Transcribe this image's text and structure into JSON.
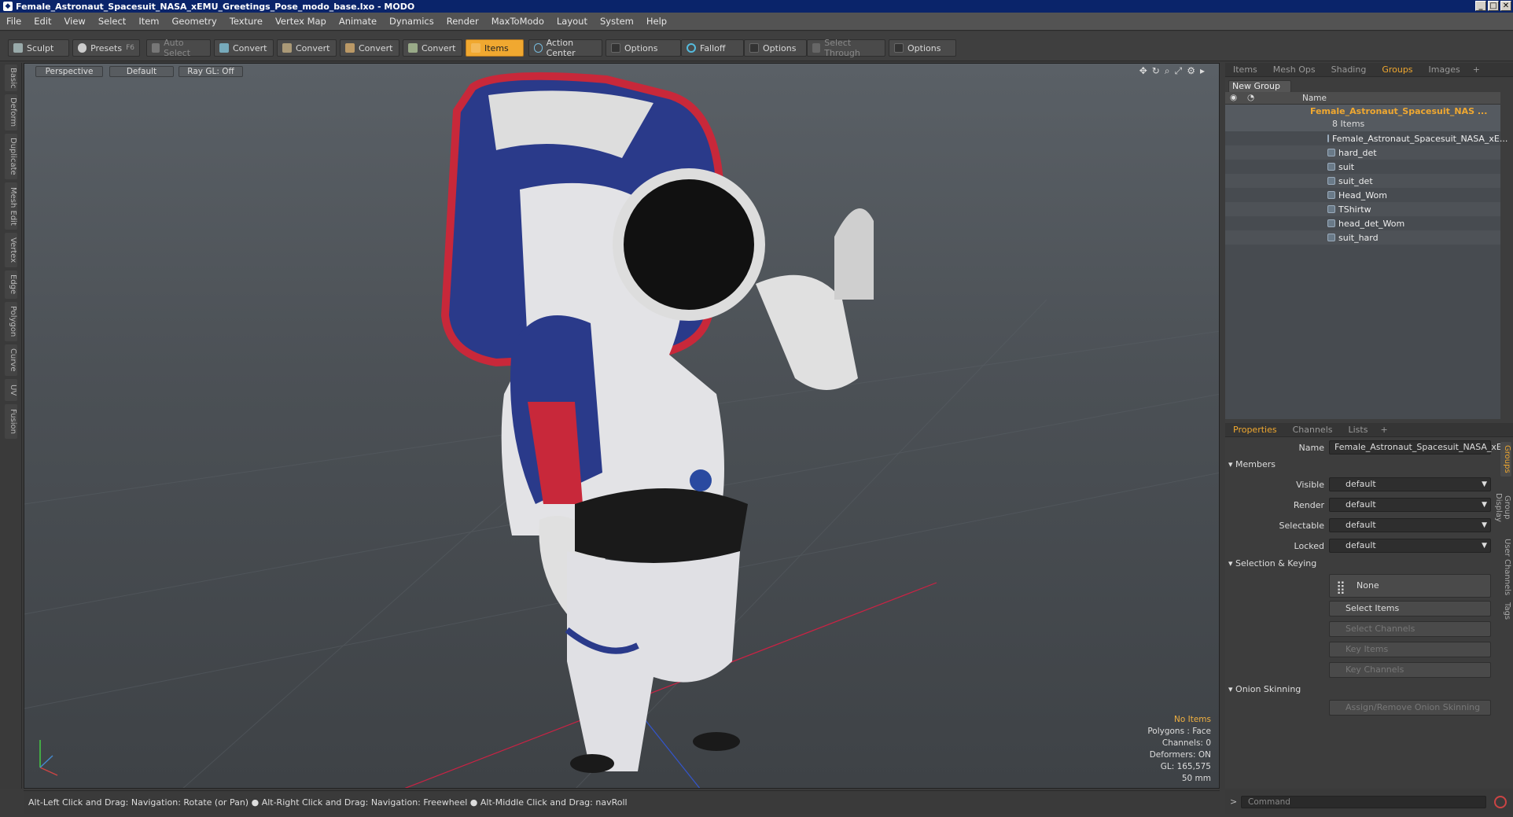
{
  "window": {
    "title": "Female_Astronaut_Spacesuit_NASA_xEMU_Greetings_Pose_modo_base.lxo - MODO",
    "min": "_",
    "max": "□",
    "close": "✕"
  },
  "menu": [
    "File",
    "Edit",
    "View",
    "Select",
    "Item",
    "Geometry",
    "Texture",
    "Vertex Map",
    "Animate",
    "Dynamics",
    "Render",
    "MaxToModo",
    "Layout",
    "System",
    "Help"
  ],
  "toolbar": {
    "sculpt": "Sculpt",
    "presets": "Presets",
    "presets_key": "F6",
    "auto_select": "Auto Select",
    "convert1": "Convert",
    "convert2": "Convert",
    "convert3": "Convert",
    "convert4": "Convert",
    "items": "Items",
    "action_center": "Action Center",
    "options1": "Options",
    "falloff": "Falloff",
    "options2": "Options",
    "select_through": "Select Through",
    "options3": "Options"
  },
  "side_tabs": [
    "Basic",
    "Deform",
    "Duplicate",
    "Mesh Edit",
    "Vertex",
    "Edge",
    "Polygon",
    "Curve",
    "UV",
    "Fusion"
  ],
  "viewport": {
    "perspective": "Perspective",
    "default": "Default",
    "raygl": "Ray GL: Off",
    "info": {
      "no_items": "No Items",
      "polygons": "Polygons : Face",
      "channels": "Channels: 0",
      "deformers": "Deformers: ON",
      "gl": "GL: 165,575",
      "scale": "50 mm"
    },
    "axis": {
      "y": "Y",
      "x": "X",
      "z": "Z"
    }
  },
  "status": "Alt-Left Click and Drag: Navigation: Rotate (or Pan) ● Alt-Right Click and Drag: Navigation: Freewheel ● Alt-Middle Click and Drag: navRoll",
  "panel_tabs": [
    "Items",
    "Mesh Ops",
    "Shading",
    "Groups",
    "Images"
  ],
  "panel_tabs_selected": "Groups",
  "new_group": "New Group",
  "tree_header": "Name",
  "group": {
    "name": "Female_Astronaut_Spacesuit_NAS ...",
    "count": "8 Items"
  },
  "tree_items": [
    "Female_Astronaut_Spacesuit_NASA_xE...",
    "hard_det",
    "suit",
    "suit_det",
    "Head_Wom",
    "TShirtw",
    "head_det_Wom",
    "suit_hard"
  ],
  "prop_tabs": [
    "Properties",
    "Channels",
    "Lists"
  ],
  "props": {
    "name_label": "Name",
    "name_value": "Female_Astronaut_Spacesuit_NASA_xEM",
    "members": "Members",
    "visible_label": "Visible",
    "visible_value": "default",
    "render_label": "Render",
    "render_value": "default",
    "selectable_label": "Selectable",
    "selectable_value": "default",
    "locked_label": "Locked",
    "locked_value": "default",
    "selection_keying": "Selection & Keying",
    "none": "None",
    "select_items": "Select Items",
    "select_channels": "Select Channels",
    "key_items": "Key Items",
    "key_channels": "Key Channels",
    "onion": "Onion Skinning",
    "assign_onion": "Assign/Remove Onion Skinning"
  },
  "vertical_tabs": [
    "Groups",
    "Group Display",
    "User Channels",
    "Tags"
  ],
  "command_placeholder": "Command",
  "colors": {
    "accent": "#f0a830",
    "title_bg": "#0a246a",
    "suit_blue": "#2a3a8a",
    "suit_red": "#c8283a"
  }
}
